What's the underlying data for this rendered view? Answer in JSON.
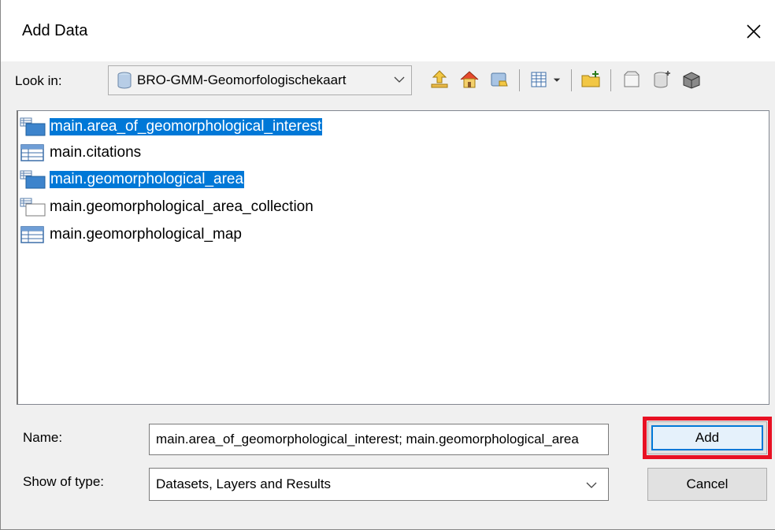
{
  "window": {
    "title": "Add Data",
    "close_icon": "close-icon"
  },
  "lookin": {
    "label": "Look in:",
    "value": "BRO-GMM-Geomorfologischekaart",
    "icon": "database-icon"
  },
  "toolbar": {
    "icons": [
      "up-one-level-icon",
      "home-icon",
      "connect-folder-icon",
      "list-view-icon",
      "view-dropdown-icon",
      "new-folder-icon",
      "new-file-icon",
      "new-geodatabase-icon",
      "new-toolbox-icon"
    ]
  },
  "list": {
    "items": [
      {
        "label": "main.area_of_geomorphological_interest",
        "icon": "polygon-layer-icon",
        "selected": true
      },
      {
        "label": "main.citations",
        "icon": "table-icon",
        "selected": false
      },
      {
        "label": "main.geomorphological_area",
        "icon": "polygon-layer-icon",
        "selected": true
      },
      {
        "label": "main.geomorphological_area_collection",
        "icon": "polygon-layer-icon",
        "selected": false
      },
      {
        "label": "main.geomorphological_map",
        "icon": "table-icon",
        "selected": false
      }
    ]
  },
  "form": {
    "name_label": "Name:",
    "name_value": "main.area_of_geomorphological_interest; main.geomorphological_area",
    "type_label": "Show of type:",
    "type_value": "Datasets, Layers and Results"
  },
  "buttons": {
    "add": "Add",
    "cancel": "Cancel"
  },
  "colors": {
    "selection": "#0078d7",
    "highlight_box": "#e81123"
  }
}
